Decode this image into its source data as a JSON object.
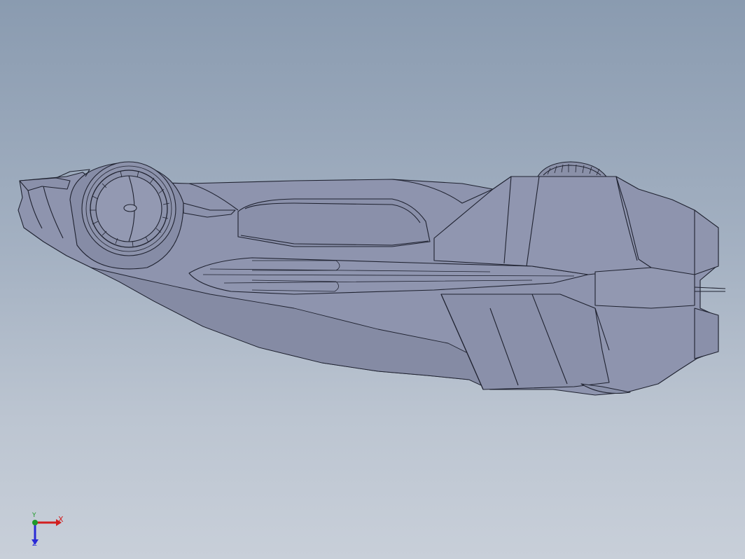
{
  "viewport": {
    "background_top": "#8a9bb0",
    "background_bottom": "#c8cfd9",
    "model_fill": "#8e94ae",
    "model_shade": "#7a7f98",
    "edge_color": "#1f2230"
  },
  "triad": {
    "x_label": "X",
    "y_label": "Y",
    "z_label": "Z",
    "x_color": "#d21f1f",
    "y_color": "#1f9a2a",
    "z_color": "#2a2ad6"
  }
}
